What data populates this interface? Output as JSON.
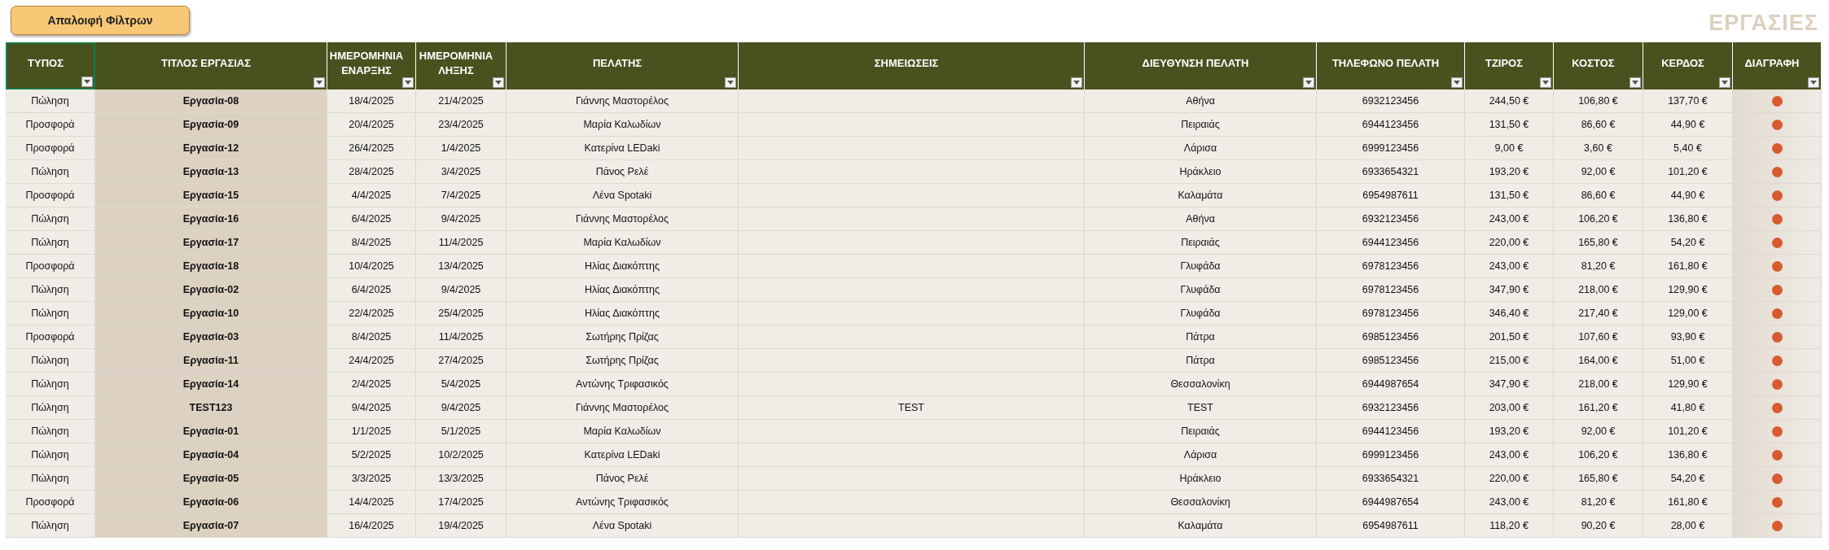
{
  "clear_filters_button": "Απαλοιφή Φίλτρων",
  "sheet_title": "ΕΡΓΑΣΙΕΣ",
  "table": {
    "columns": [
      {
        "label": "ΤΥΠΟΣ",
        "kind": "text",
        "selected": true
      },
      {
        "label": "ΤΙΤΛΟΣ ΕΡΓΑΣΙΑΣ",
        "kind": "title",
        "selected": false
      },
      {
        "label": "ΗΜΕΡΟΜΗΝΙΑ ΕΝΑΡΞΗΣ",
        "kind": "text",
        "selected": false
      },
      {
        "label": "ΗΜΕΡΟΜΗΝΙΑ ΛΗΞΗΣ",
        "kind": "text",
        "selected": false
      },
      {
        "label": "ΠΕΛΑΤΗΣ",
        "kind": "text",
        "selected": false
      },
      {
        "label": "ΣΗΜΕΙΩΣΕΙΣ",
        "kind": "text",
        "selected": false
      },
      {
        "label": "ΔΙΕΥΘΥΝΣΗ ΠΕΛΑΤΗ",
        "kind": "text",
        "selected": false
      },
      {
        "label": "ΤΗΛΕΦΩΝΟ ΠΕΛΑΤΗ",
        "kind": "text",
        "selected": false
      },
      {
        "label": "ΤΖΙΡΟΣ",
        "kind": "text",
        "selected": false
      },
      {
        "label": "ΚΟΣΤΟΣ",
        "kind": "text",
        "selected": false
      },
      {
        "label": "ΚΕΡΔΟΣ",
        "kind": "text",
        "selected": false
      },
      {
        "label": "ΔΙΑΓΡΑΦΗ",
        "kind": "delete",
        "selected": false
      }
    ],
    "rows": [
      {
        "type": "Πώληση",
        "title": "Εργασία-08",
        "start": "18/4/2025",
        "end": "21/4/2025",
        "client": "Γιάννης Μαστορέλος",
        "address": "Αθήνα",
        "phone": "6932123456",
        "revenue": "244,50 €",
        "cost": "106,80 €",
        "profit": "137,70 €"
      },
      {
        "type": "Προσφορά",
        "title": "Εργασία-09",
        "start": "20/4/2025",
        "end": "23/4/2025",
        "client": "Μαρία Καλωδίων",
        "address": "Πειραιάς",
        "phone": "6944123456",
        "revenue": "131,50 €",
        "cost": "86,60 €",
        "profit": "44,90 €"
      },
      {
        "type": "Προσφορά",
        "title": "Εργασία-12",
        "start": "26/4/2025",
        "end": "1/4/2025",
        "client": "Κατερίνα LEDaki",
        "address": "Λάρισα",
        "phone": "6999123456",
        "revenue": "9,00 €",
        "cost": "3,60 €",
        "profit": "5,40 €"
      },
      {
        "type": "Πώληση",
        "title": "Εργασία-13",
        "start": "28/4/2025",
        "end": "3/4/2025",
        "client": "Πάνος Ρελέ",
        "address": "Ηράκλειο",
        "phone": "6933654321",
        "revenue": "193,20 €",
        "cost": "92,00 €",
        "profit": "101,20 €"
      },
      {
        "type": "Προσφορά",
        "title": "Εργασία-15",
        "start": "4/4/2025",
        "end": "7/4/2025",
        "client": "Λένα Spotaki",
        "address": "Καλαμάτα",
        "phone": "6954987611",
        "revenue": "131,50 €",
        "cost": "86,60 €",
        "profit": "44,90 €"
      },
      {
        "type": "Πώληση",
        "title": "Εργασία-16",
        "start": "6/4/2025",
        "end": "9/4/2025",
        "client": "Γιάννης Μαστορέλος",
        "address": "Αθήνα",
        "phone": "6932123456",
        "revenue": "243,00 €",
        "cost": "106,20 €",
        "profit": "136,80 €"
      },
      {
        "type": "Πώληση",
        "title": "Εργασία-17",
        "start": "8/4/2025",
        "end": "11/4/2025",
        "client": "Μαρία Καλωδίων",
        "address": "Πειραιάς",
        "phone": "6944123456",
        "revenue": "220,00 €",
        "cost": "165,80 €",
        "profit": "54,20 €"
      },
      {
        "type": "Προσφορά",
        "title": "Εργασία-18",
        "start": "10/4/2025",
        "end": "13/4/2025",
        "client": "Ηλίας Διακόπτης",
        "address": "Γλυφάδα",
        "phone": "6978123456",
        "revenue": "243,00 €",
        "cost": "81,20 €",
        "profit": "161,80 €"
      },
      {
        "type": "Πώληση",
        "title": "Εργασία-02",
        "start": "6/4/2025",
        "end": "9/4/2025",
        "client": "Ηλίας Διακόπτης",
        "address": "Γλυφάδα",
        "phone": "6978123456",
        "revenue": "347,90 €",
        "cost": "218,00 €",
        "profit": "129,90 €"
      },
      {
        "type": "Πώληση",
        "title": "Εργασία-10",
        "start": "22/4/2025",
        "end": "25/4/2025",
        "client": "Ηλίας Διακόπτης",
        "address": "Γλυφάδα",
        "phone": "6978123456",
        "revenue": "346,40 €",
        "cost": "217,40 €",
        "profit": "129,00 €"
      },
      {
        "type": "Προσφορά",
        "title": "Εργασία-03",
        "start": "8/4/2025",
        "end": "11/4/2025",
        "client": "Σωτήρης Πρίζας",
        "address": "Πάτρα",
        "phone": "6985123456",
        "revenue": "201,50 €",
        "cost": "107,60 €",
        "profit": "93,90 €"
      },
      {
        "type": "Πώληση",
        "title": "Εργασία-11",
        "start": "24/4/2025",
        "end": "27/4/2025",
        "client": "Σωτήρης Πρίζας",
        "address": "Πάτρα",
        "phone": "6985123456",
        "revenue": "215,00 €",
        "cost": "164,00 €",
        "profit": "51,00 €"
      },
      {
        "type": "Πώληση",
        "title": "Εργασία-14",
        "start": "2/4/2025",
        "end": "5/4/2025",
        "client": "Αντώνης Τριφασικός",
        "address": "Θεσσαλονίκη",
        "phone": "6944987654",
        "revenue": "347,90 €",
        "cost": "218,00 €",
        "profit": "129,90 €"
      },
      {
        "type": "Πώληση",
        "title": "TEST123",
        "start": "9/4/2025",
        "end": "9/4/2025",
        "client": "Γιάννης Μαστορέλος",
        "notes": "TEST",
        "address": "TEST",
        "phone": "6932123456",
        "revenue": "203,00 €",
        "cost": "161,20 €",
        "profit": "41,80 €"
      },
      {
        "type": "Πώληση",
        "title": "Εργασία-01",
        "start": "1/1/2025",
        "end": "5/1/2025",
        "client": "Μαρία Καλωδίων",
        "address": "Πειραιάς",
        "phone": "6944123456",
        "revenue": "193,20 €",
        "cost": "92,00 €",
        "profit": "101,20 €"
      },
      {
        "type": "Πώληση",
        "title": "Εργασία-04",
        "start": "5/2/2025",
        "end": "10/2/2025",
        "client": "Κατερίνα LEDaki",
        "address": "Λάρισα",
        "phone": "6999123456",
        "revenue": "243,00 €",
        "cost": "106,20 €",
        "profit": "136,80 €"
      },
      {
        "type": "Πώληση",
        "title": "Εργασία-05",
        "start": "3/3/2025",
        "end": "13/3/2025",
        "client": "Πάνος Ρελέ",
        "address": "Ηράκλειο",
        "phone": "6933654321",
        "revenue": "220,00 €",
        "cost": "165,80 €",
        "profit": "54,20 €"
      },
      {
        "type": "Προσφορά",
        "title": "Εργασία-06",
        "start": "14/4/2025",
        "end": "17/4/2025",
        "client": "Αντώνης Τριφασικός",
        "address": "Θεσσαλονίκη",
        "phone": "6944987654",
        "revenue": "243,00 €",
        "cost": "81,20 €",
        "profit": "161,80 €"
      },
      {
        "type": "Πώληση",
        "title": "Εργασία-07",
        "start": "16/4/2025",
        "end": "19/4/2025",
        "client": "Λένα Spotaki",
        "address": "Καλαμάτα",
        "phone": "6954987611",
        "revenue": "118,20 €",
        "cost": "90,20 €",
        "profit": "28,00 €"
      }
    ]
  }
}
